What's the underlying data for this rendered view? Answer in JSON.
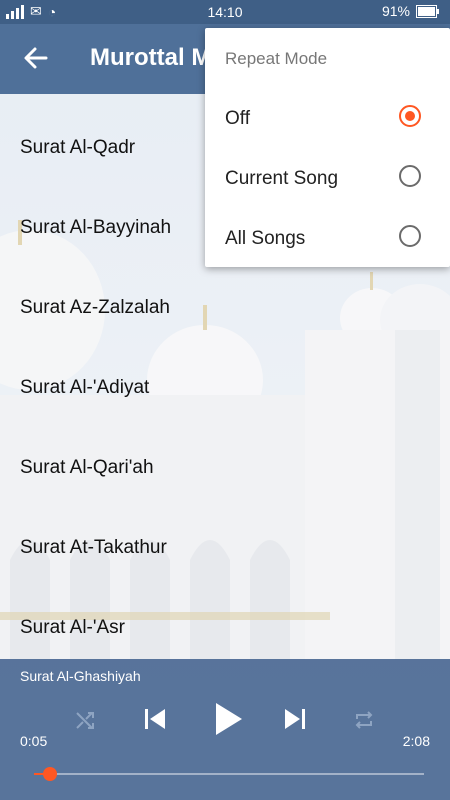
{
  "status_bar": {
    "time": "14:10",
    "battery": "91%"
  },
  "app_bar": {
    "title": "Murottal M"
  },
  "list": {
    "items": [
      "Surat Al-Qadr",
      "Surat Al-Bayyinah",
      "Surat Az-Zalzalah",
      "Surat Al-'Adiyat",
      "Surat Al-Qari'ah",
      "Surat At-Takathur",
      "Surat Al-'Asr"
    ]
  },
  "player": {
    "now_playing": "Surat Al-Ghashiyah",
    "elapsed": "0:05",
    "duration": "2:08",
    "progress": 0.04
  },
  "popup": {
    "heading": "Repeat Mode",
    "options": [
      {
        "label": "Off",
        "selected": true
      },
      {
        "label": "Current Song",
        "selected": false
      },
      {
        "label": "All Songs",
        "selected": false
      }
    ]
  },
  "colors": {
    "accent": "#ff5722",
    "app_bar": "#4f7099",
    "player_bg": "#4b6892"
  },
  "icons": {
    "back": "arrow-left-icon",
    "shuffle": "shuffle-icon",
    "previous": "skip-previous-icon",
    "play": "play-icon",
    "next": "skip-next-icon",
    "repeat": "repeat-icon"
  }
}
